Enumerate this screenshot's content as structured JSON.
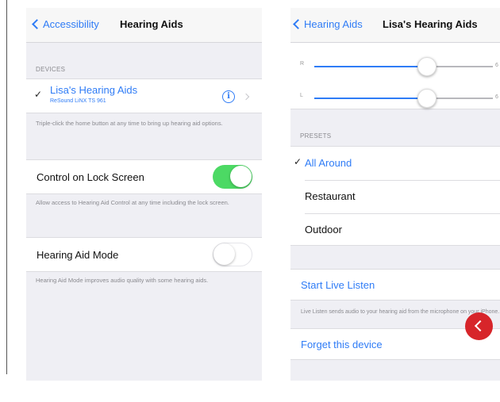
{
  "left": {
    "nav": {
      "back": "Accessibility",
      "title": "Hearing Aids"
    },
    "devices_header": "DEVICES",
    "device": {
      "name": "Lisa's Hearing Aids",
      "model": "ReSound LiNX TS 961"
    },
    "devices_footer": "Triple-click the home button at any time to bring up hearing aid options.",
    "lock_screen": {
      "label": "Control on Lock Screen",
      "on": true
    },
    "lock_footer": "Allow access to Hearing Aid Control at any time including the lock screen.",
    "hearing_mode": {
      "label": "Hearing Aid Mode",
      "on": false
    },
    "mode_footer": "Hearing Aid Mode improves audio quality with some hearing aids."
  },
  "right": {
    "nav": {
      "back": "Hearing Aids",
      "title": "Lisa's Hearing Aids"
    },
    "sliders": [
      {
        "label": "R",
        "end": "6"
      },
      {
        "label": "L",
        "end": "6"
      }
    ],
    "presets_header": "PRESETS",
    "presets": [
      {
        "label": "All Around",
        "selected": true
      },
      {
        "label": "Restaurant",
        "selected": false
      },
      {
        "label": "Outdoor",
        "selected": false
      }
    ],
    "live_listen": "Start Live Listen",
    "live_footer": "Live Listen sends audio to your hearing aid from the microphone on your iPhone.",
    "forget": "Forget this device"
  },
  "colors": {
    "accent": "#2f7cf6",
    "toggle_on": "#4cd964",
    "red_button": "#d7252a"
  },
  "icons": {
    "back": "chevron-left-icon",
    "info": "info-circle-icon",
    "check": "checkmark-icon",
    "red": "chevron-left-icon"
  }
}
